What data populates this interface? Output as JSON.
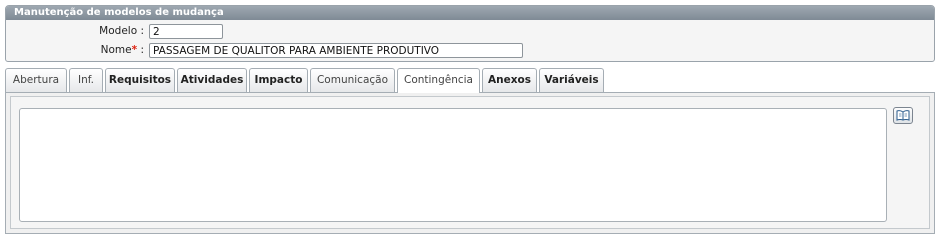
{
  "panel": {
    "title": "Manutenção de modelos de mudança",
    "fields": {
      "modelo_label": "Modelo :",
      "modelo_value": "2",
      "nome_label": "Nome",
      "nome_required": "*",
      "nome_colon": " :",
      "nome_value": "PASSAGEM DE QUALITOR PARA AMBIENTE PRODUTIVO"
    }
  },
  "tabs": [
    {
      "label": "Abertura"
    },
    {
      "label": "Inf."
    },
    {
      "label": "Requisitos"
    },
    {
      "label": "Atividades"
    },
    {
      "label": "Impacto"
    },
    {
      "label": "Comunicação"
    },
    {
      "label": "Contingência"
    },
    {
      "label": "Anexos"
    },
    {
      "label": "Variáveis"
    }
  ],
  "active_tab": "Contingência",
  "content": {
    "textarea_value": "",
    "book_icon": "book-icon"
  }
}
